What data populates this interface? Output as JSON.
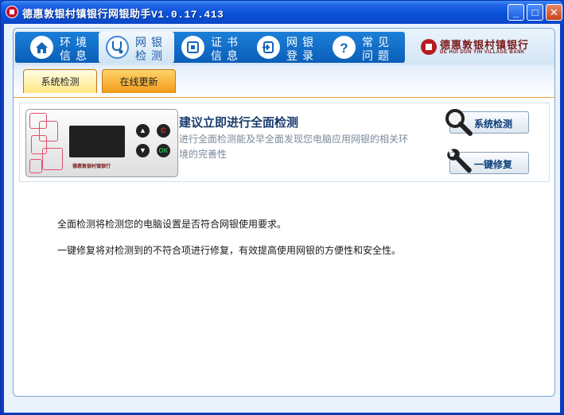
{
  "window": {
    "title": "德惠敦银村镇银行网银助手V1.0.17.413",
    "minimize_glyph": "_",
    "maximize_glyph": "□",
    "close_glyph": "✕"
  },
  "nav": {
    "items": [
      {
        "line1": "环境",
        "line2": "信息",
        "icon": "home-icon"
      },
      {
        "line1": "网银",
        "line2": "检测",
        "icon": "stethoscope-icon"
      },
      {
        "line1": "证书",
        "line2": "信息",
        "icon": "certificate-icon"
      },
      {
        "line1": "网银",
        "line2": "登录",
        "icon": "login-icon"
      },
      {
        "line1": "常见",
        "line2": "问题",
        "icon": "question-icon"
      }
    ],
    "active_index": 1
  },
  "bank": {
    "name_cn": "德惠敦银村镇银行",
    "name_en": "DE HUI DUN YIN VILLAGE BANK"
  },
  "subtabs": [
    "系统检测",
    "在线更新"
  ],
  "check": {
    "title": "建议立即进行全面检测",
    "desc": "进行全面检测能及早全面发现您电脑应用网银的相关环境的完善性",
    "device_label": "德惠敦银村镇银行",
    "device_c": "C",
    "device_ok": "OK",
    "scan_button": "系统检测",
    "repair_button": "一键修复"
  },
  "info": {
    "line1": "全面检测将检测您的电脑设置是否符合网银使用要求。",
    "line2": "一键修复将对检测到的不符合项进行修复，有效提高使用网银的方便性和安全性。"
  },
  "colors": {
    "titlebar": "#0a51d8",
    "nav_strip": "#0a5fb8",
    "active_subtab": "#ffe783",
    "inactive_subtab": "#f29a1a",
    "brand_red": "#b51c22"
  }
}
